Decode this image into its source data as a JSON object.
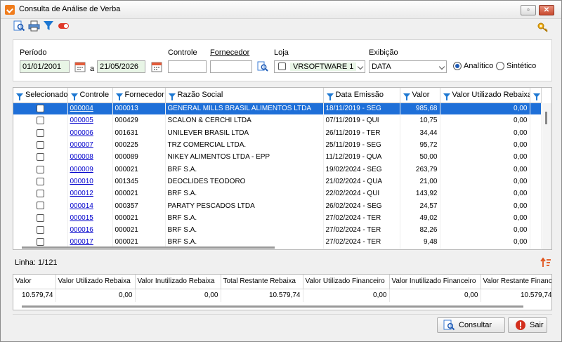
{
  "window": {
    "title": "Consulta de Análise de Verba"
  },
  "filters": {
    "periodo_label": "Período",
    "date_from": "01/01/2001",
    "date_sep": "a",
    "date_to": "21/05/2026",
    "controle_label": "Controle",
    "controle_value": "",
    "fornecedor_label": "Fornecedor",
    "fornecedor_value": "",
    "loja_label": "Loja",
    "loja_value": "VRSOFTWARE 1",
    "exibicao_label": "Exibição",
    "exibicao_value": "DATA",
    "radio_analitico": "Analítico",
    "radio_sintetico": "Sintético"
  },
  "grid": {
    "columns": [
      "Selecionado",
      "Controle",
      "Fornecedor",
      "Razão Social",
      "Data Emissão",
      "Valor",
      "Valor Utilizado Rebaixa"
    ],
    "rows": [
      {
        "controle": "000004",
        "fornecedor": "000013",
        "razao": "GENERAL MILLS BRASIL ALIMENTOS LTDA",
        "data": "18/11/2019 - SEG",
        "valor": "985,68",
        "utilizado": "0,00"
      },
      {
        "controle": "000005",
        "fornecedor": "000429",
        "razao": "SCALON & CERCHI LTDA",
        "data": "07/11/2019 - QUI",
        "valor": "10,75",
        "utilizado": "0,00"
      },
      {
        "controle": "000006",
        "fornecedor": "001631",
        "razao": "UNILEVER BRASIL LTDA",
        "data": "26/11/2019 - TER",
        "valor": "34,44",
        "utilizado": "0,00"
      },
      {
        "controle": "000007",
        "fornecedor": "000225",
        "razao": "TRZ COMERCIAL LTDA.",
        "data": "25/11/2019 - SEG",
        "valor": "95,72",
        "utilizado": "0,00"
      },
      {
        "controle": "000008",
        "fornecedor": "000089",
        "razao": "NIKEY ALIMENTOS LTDA - EPP",
        "data": "11/12/2019 - QUA",
        "valor": "50,00",
        "utilizado": "0,00"
      },
      {
        "controle": "000009",
        "fornecedor": "000021",
        "razao": "BRF S.A.",
        "data": "19/02/2024 - SEG",
        "valor": "263,79",
        "utilizado": "0,00"
      },
      {
        "controle": "000010",
        "fornecedor": "001345",
        "razao": "DEOCLIDES TEODORO",
        "data": "21/02/2024 - QUA",
        "valor": "21,00",
        "utilizado": "0,00"
      },
      {
        "controle": "000012",
        "fornecedor": "000021",
        "razao": "BRF S.A.",
        "data": "22/02/2024 - QUI",
        "valor": "143,92",
        "utilizado": "0,00"
      },
      {
        "controle": "000014",
        "fornecedor": "000357",
        "razao": "PARATY PESCADOS LTDA",
        "data": "26/02/2024 - SEG",
        "valor": "24,57",
        "utilizado": "0,00"
      },
      {
        "controle": "000015",
        "fornecedor": "000021",
        "razao": "BRF S.A.",
        "data": "27/02/2024 - TER",
        "valor": "49,02",
        "utilizado": "0,00"
      },
      {
        "controle": "000016",
        "fornecedor": "000021",
        "razao": "BRF S.A.",
        "data": "27/02/2024 - TER",
        "valor": "82,26",
        "utilizado": "0,00"
      },
      {
        "controle": "000017",
        "fornecedor": "000021",
        "razao": "BRF S.A.",
        "data": "27/02/2024 - TER",
        "valor": "9,48",
        "utilizado": "0,00"
      }
    ]
  },
  "status": {
    "linha": "Linha: 1/121"
  },
  "totals": {
    "columns": [
      "Valor",
      "Valor Utilizado Rebaixa",
      "Valor Inutilizado Rebaixa",
      "Total Restante Rebaixa",
      "Valor Utilizado Financeiro",
      "Valor Inutilizado Financeiro",
      "Valor Restante Financeiro"
    ],
    "values": [
      "10.579,74",
      "0,00",
      "0,00",
      "10.579,74",
      "0,00",
      "0,00",
      "10.579,74"
    ]
  },
  "buttons": {
    "consultar": "Consultar",
    "sair": "Sair"
  },
  "colors": {
    "accent": "#1e6fd8",
    "app_icon": "#f07c1c",
    "funnel": "#1e78d2",
    "exit": "#d32f1d"
  }
}
